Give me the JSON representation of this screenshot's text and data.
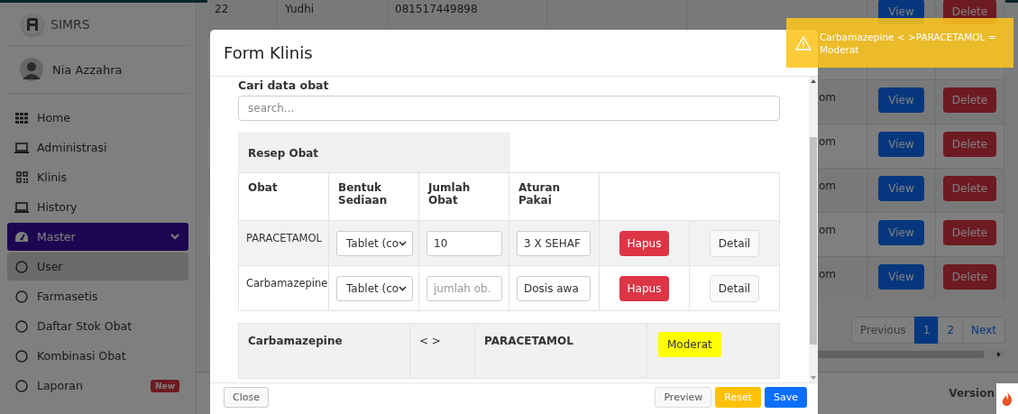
{
  "sidebar": {
    "brand": "SIMRS",
    "user": "Nia Azzahra",
    "items": [
      {
        "label": "Home",
        "selected": false
      },
      {
        "label": "Administrasi",
        "selected": false
      },
      {
        "label": "Klinis",
        "selected": false
      },
      {
        "label": "History",
        "selected": false
      },
      {
        "label": "Master",
        "selected": true,
        "expanded": true,
        "children": [
          {
            "label": "User",
            "selected": true
          },
          {
            "label": "Farmasetis",
            "selected": false
          },
          {
            "label": "Daftar Stok Obat",
            "selected": false
          },
          {
            "label": "Kombinasi Obat",
            "selected": false
          },
          {
            "label": "Laporan",
            "selected": false,
            "badge": "New"
          }
        ]
      }
    ]
  },
  "background_table": {
    "rows": [
      {
        "no": "22",
        "name": "Yudhi",
        "phone": "081517449898",
        "email": "",
        "view": "View",
        "delete": "Delete"
      },
      {},
      {
        "email": "om",
        "view": "View",
        "delete": "Delete"
      },
      {
        "email": "om",
        "view": "View",
        "delete": "Delete"
      },
      {
        "email": "om",
        "view": "View",
        "delete": "Delete"
      },
      {
        "email": "om",
        "view": "View",
        "delete": "Delete"
      },
      {
        "email": "om",
        "view": "View",
        "delete": "Delete"
      }
    ],
    "pagination": [
      {
        "label": "Previous",
        "selected": false
      },
      {
        "label": "1",
        "selected": true
      },
      {
        "label": "2",
        "selected": false
      },
      {
        "label": "Next",
        "selected": false
      }
    ]
  },
  "footer": {
    "version": "Version"
  },
  "modal": {
    "title": "Form Klinis",
    "search_label": "Cari data obat",
    "search": {
      "placeholder": "search..."
    },
    "recipe_table": {
      "title": "Resep Obat",
      "columns": [
        "Obat",
        "Bentuk Sediaan",
        "Jumlah Obat",
        "Aturan Pakai"
      ],
      "rows": [
        {
          "obat": "PARACETAMOL",
          "bentuk": "Tablet (co",
          "jumlah": {
            "value": "10"
          },
          "aturan": {
            "value": "3 X SEHAF"
          },
          "remove": "Hapus",
          "detail": "Detail"
        },
        {
          "obat": "Carbamazepine",
          "bentuk": "Tablet (co",
          "jumlah": {
            "placeholder": "jumlah ob."
          },
          "aturan": {
            "value": "Dosis awa"
          },
          "remove": "Hapus",
          "detail": "Detail"
        }
      ]
    },
    "interaction": {
      "drug_a": "Carbamazepine",
      "separator": "< >",
      "drug_b": "PARACETAMOL",
      "severity": "Moderat",
      "color": "#ffff00"
    },
    "buttons": [
      {
        "label": "Close",
        "kind": "secondary"
      },
      {
        "label": "Preview",
        "kind": "light"
      },
      {
        "label": "Reset",
        "kind": "warning"
      },
      {
        "label": "Save",
        "kind": "primary"
      }
    ]
  },
  "toast": {
    "message": "Carbamazepine < >PARACETAMOL = Moderat"
  }
}
